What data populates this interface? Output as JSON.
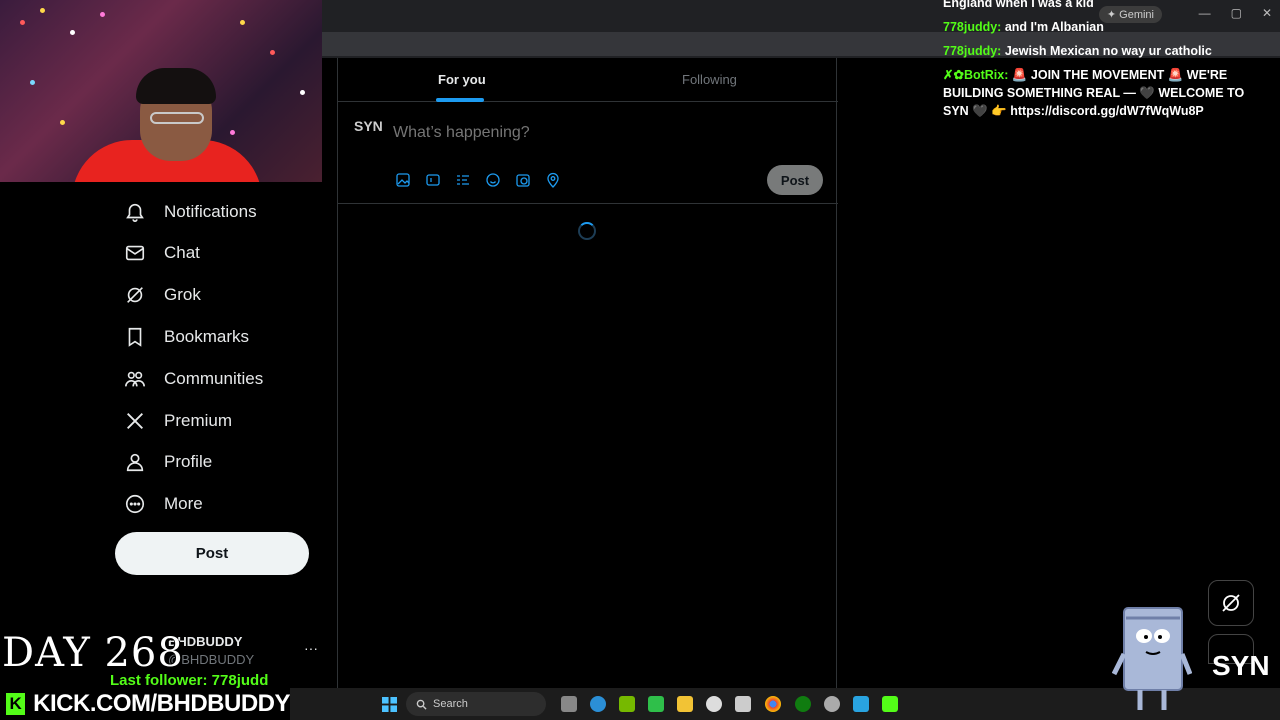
{
  "browser": {
    "gemini_label": "✦ Gemini",
    "window_controls": [
      "—",
      "▢",
      "✕"
    ]
  },
  "nav": {
    "items": [
      {
        "label": "Notifications",
        "icon": "bell-icon"
      },
      {
        "label": "Chat",
        "icon": "mail-icon"
      },
      {
        "label": "Grok",
        "icon": "grok-icon"
      },
      {
        "label": "Bookmarks",
        "icon": "bookmark-icon"
      },
      {
        "label": "Communities",
        "icon": "people-icon"
      },
      {
        "label": "Premium",
        "icon": "x-logo-icon"
      },
      {
        "label": "Profile",
        "icon": "person-icon"
      },
      {
        "label": "More",
        "icon": "more-circle-icon"
      }
    ],
    "post_label": "Post"
  },
  "account": {
    "name": "BHDBUDDY",
    "handle": "@BHDBUDDY",
    "more": "···"
  },
  "main": {
    "tabs": [
      {
        "label": "For you",
        "active": true
      },
      {
        "label": "Following",
        "active": false
      }
    ],
    "composer": {
      "avatar_text": "SYN",
      "placeholder": "What’s happening?",
      "post_label": "Post",
      "tools": [
        "image-icon",
        "gif-icon",
        "poll-icon",
        "emoji-icon",
        "schedule-icon",
        "location-icon"
      ]
    }
  },
  "chat": {
    "lines": [
      {
        "user": "",
        "text": "England when I was a kid"
      },
      {
        "user": "778juddy:",
        "text": "and I'm Albanian"
      },
      {
        "user": "778juddy:",
        "text": "Jewish Mexican no way ur catholic"
      },
      {
        "user": "✗✿BotRix:",
        "text": "🚨 JOIN THE MOVEMENT 🚨 WE'RE BUILDING SOMETHING REAL — 🖤 WELCOME TO SYN 🖤 👉 https://discord.gg/dW7fWqWu8P"
      }
    ]
  },
  "overlay": {
    "day_counter": "DAY 268",
    "last_follower": "Last follower: 778judd",
    "kick_url": "KICK.COM/BHDBUDDY",
    "kick_logo": "K",
    "syn_logo": "SYN"
  },
  "taskbar": {
    "search_label": "Search"
  },
  "colors": {
    "accent": "#1d9bf0",
    "kick_green": "#53fc18",
    "background": "#000000"
  }
}
